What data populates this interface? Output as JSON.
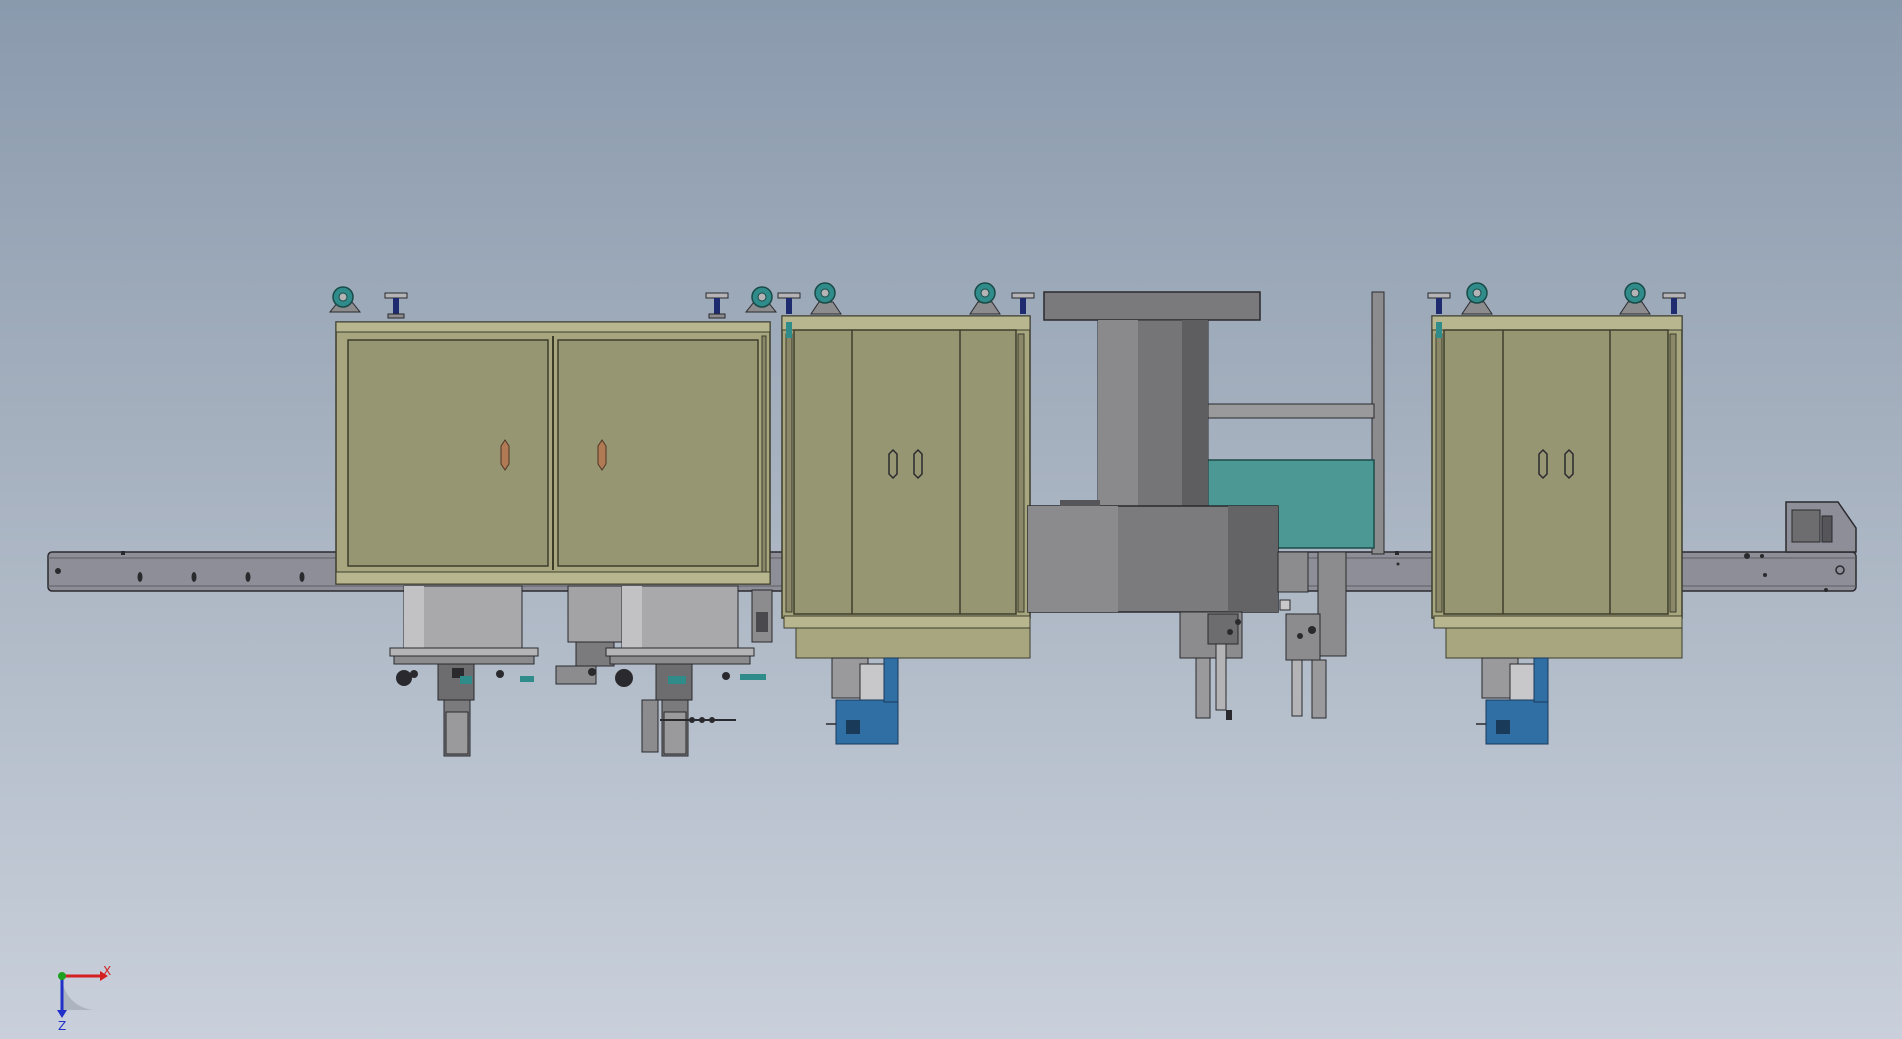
{
  "view": {
    "background_top": "#8a9aad",
    "background_bottom": "#c9d0db"
  },
  "colors": {
    "cabinet": "#979672",
    "cabinet_frame": "#a8a67f",
    "cabinet_edge": "#3d3d2c",
    "rail": "#8e8e98",
    "rail_edge": "#2a2a2e",
    "steel_dark": "#6d6d70",
    "steel_mid": "#8c8c8e",
    "steel_light": "#b4b4b6",
    "caster": "#2f8c8a",
    "leveler": "#1e2b6e",
    "teal_panel": "#4b9894",
    "blue_unit": "#2f6fa4",
    "handle_copper": "#b07a55",
    "axis_x": "#d42020",
    "axis_y": "#20a020",
    "axis_z": "#2030c8"
  },
  "triad": {
    "x_label": "X",
    "z_label": "Z"
  }
}
